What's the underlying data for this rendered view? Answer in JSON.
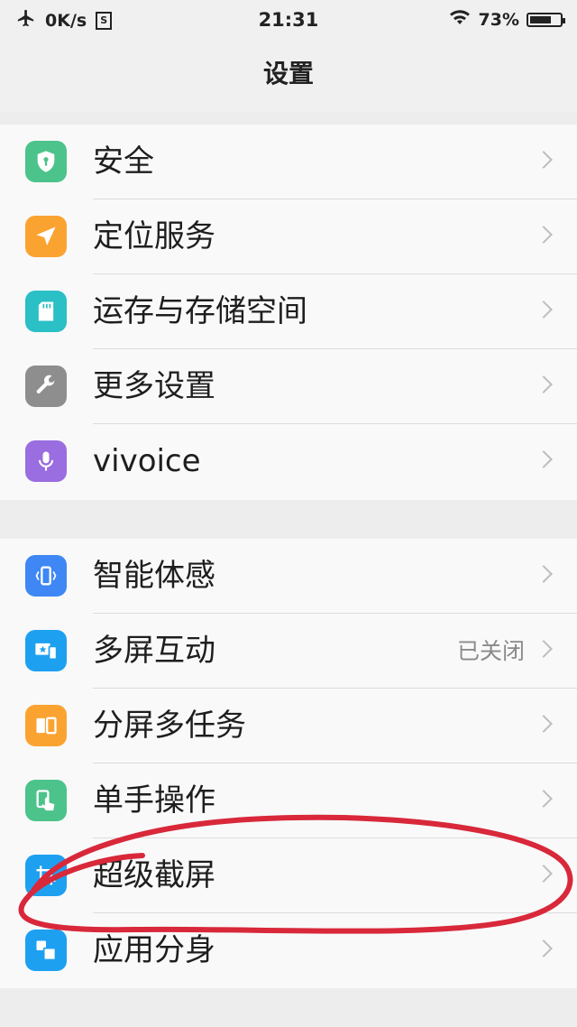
{
  "status_bar": {
    "speed": "0K/s",
    "sim_label": "S",
    "time": "21:31",
    "battery": "73%",
    "battery_level": 0.73
  },
  "header": {
    "title": "设置"
  },
  "groups": [
    {
      "items": [
        {
          "label": "安全",
          "icon": "shield-lock-icon",
          "color": "#4cc38a"
        },
        {
          "label": "定位服务",
          "icon": "location-arrow-icon",
          "color": "#fba331"
        },
        {
          "label": "运存与存储空间",
          "icon": "sd-card-icon",
          "color": "#2bbfc6"
        },
        {
          "label": "更多设置",
          "icon": "wrench-icon",
          "color": "#8e8e8e"
        },
        {
          "label": "vivoice",
          "icon": "microphone-icon",
          "color": "#9a6de0"
        }
      ]
    },
    {
      "items": [
        {
          "label": "智能体感",
          "icon": "motion-phone-icon",
          "color": "#3f87f5"
        },
        {
          "label": "多屏互动",
          "icon": "multiscreen-icon",
          "color": "#1ea0f0",
          "value": "已关闭"
        },
        {
          "label": "分屏多任务",
          "icon": "split-screen-icon",
          "color": "#fba331"
        },
        {
          "label": "单手操作",
          "icon": "one-hand-icon",
          "color": "#4cc38a"
        },
        {
          "label": "超级截屏",
          "icon": "screenshot-icon",
          "color": "#1ea0f0"
        },
        {
          "label": "应用分身",
          "icon": "app-clone-icon",
          "color": "#1ea0f0"
        }
      ]
    }
  ],
  "colors": {
    "annotation_stroke": "#d8283a",
    "divider": "#dcdcdc",
    "chevron": "#bdbdbd"
  }
}
